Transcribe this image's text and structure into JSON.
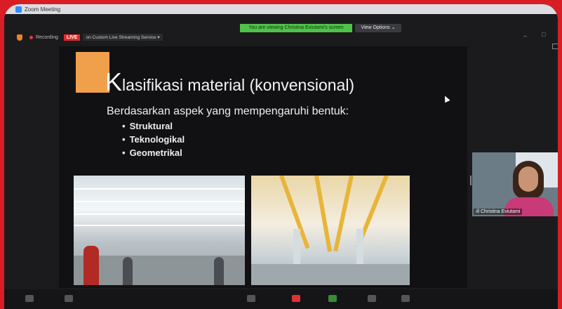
{
  "window": {
    "title": "Zoom Meeting"
  },
  "banner": {
    "viewing_text": "You are viewing Christina Eviutami's screen",
    "view_options": "View Options ⌄"
  },
  "recording": {
    "label": "Recording",
    "live": "LIVE",
    "service": "on Custom Live Streaming Service ▾"
  },
  "window_controls": {
    "minimize": "–",
    "maximize": "□"
  },
  "slide": {
    "title_initial": "K",
    "title_rest": "lasifikasi material (konvensional)",
    "subtitle": "Berdasarkan aspek yang mempengaruhi bentuk:",
    "bullets": [
      "Struktural",
      "Teknologikal",
      "Geometrikal"
    ]
  },
  "participant": {
    "name": "Christina Eviutami",
    "signal_icon": "signal-bars-icon"
  },
  "colors": {
    "frame_red": "#d81e24",
    "banner_green": "#4fc24a",
    "live_red": "#e12a2a",
    "accent_orange": "#f0a04a"
  }
}
